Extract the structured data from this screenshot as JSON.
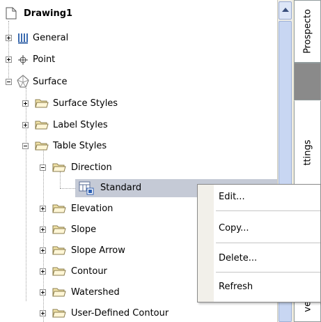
{
  "tree": {
    "root": {
      "label": "Drawing1"
    },
    "items": [
      {
        "label": "General",
        "icon": "general-icon",
        "state": "collapsed"
      },
      {
        "label": "Point",
        "icon": "point-icon",
        "state": "collapsed"
      },
      {
        "label": "Surface",
        "icon": "surface-icon",
        "state": "expanded"
      },
      {
        "label": "Surface Styles",
        "icon": "folder-icon",
        "state": "collapsed"
      },
      {
        "label": "Label Styles",
        "icon": "folder-icon",
        "state": "collapsed"
      },
      {
        "label": "Table Styles",
        "icon": "folder-icon",
        "state": "expanded"
      },
      {
        "label": "Direction",
        "icon": "folder-icon",
        "state": "expanded"
      },
      {
        "label": "Standard",
        "icon": "table-style-icon",
        "state": "selected"
      },
      {
        "label": "Elevation",
        "icon": "folder-icon",
        "state": "collapsed"
      },
      {
        "label": "Slope",
        "icon": "folder-icon",
        "state": "collapsed"
      },
      {
        "label": "Slope Arrow",
        "icon": "folder-icon",
        "state": "collapsed"
      },
      {
        "label": "Contour",
        "icon": "folder-icon",
        "state": "collapsed"
      },
      {
        "label": "Watershed",
        "icon": "folder-icon",
        "state": "collapsed"
      },
      {
        "label": "User-Defined Contour",
        "icon": "folder-icon",
        "state": "collapsed"
      }
    ]
  },
  "tabs": {
    "prospector": "Prospecto",
    "settings": "ttings",
    "survey": "vey"
  },
  "context_menu": {
    "items": [
      "Edit...",
      "Copy...",
      "Delete...",
      "Refresh"
    ]
  },
  "colors": {
    "selection": "#c5cad6",
    "folder": "#f2e3a8",
    "tree_lines": "#a0a0a0"
  }
}
